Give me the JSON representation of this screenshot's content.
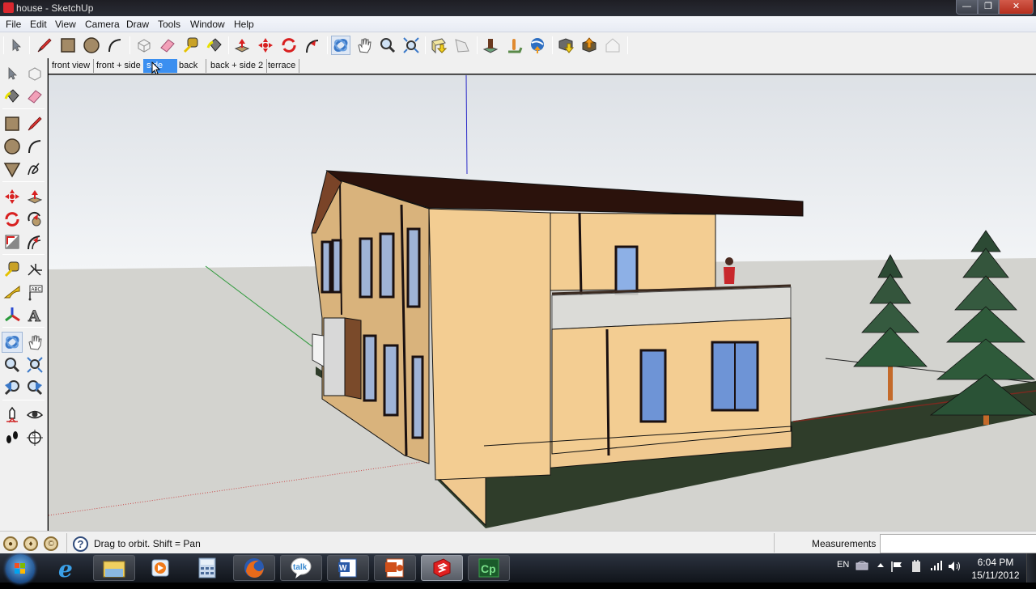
{
  "window": {
    "title": "house - SketchUp",
    "controls": {
      "minimize": "—",
      "restore": "❐",
      "close": "✕"
    }
  },
  "menu": [
    "File",
    "Edit",
    "View",
    "Camera",
    "Draw",
    "Tools",
    "Window",
    "Help"
  ],
  "toolbar": {
    "groups": [
      [
        "select-tool"
      ],
      [
        "pencil-line-tool",
        "rectangle-tool",
        "circle-tool",
        "arc-tool"
      ],
      [
        "make-component-tool",
        "eraser-tool",
        "tape-measure-tool",
        "paint-bucket-tool"
      ],
      [
        "push-pull-tool",
        "move-tool",
        "rotate-tool",
        "follow-me-tool"
      ],
      [
        "orbit-tool",
        "pan-tool",
        "zoom-tool",
        "zoom-extents-tool"
      ],
      [
        "get-models-tool",
        "share-model-tool"
      ],
      [
        "add-location-tool",
        "toggle-terrain-tool",
        "google-earth-tool"
      ],
      [
        "get-models-3dw-tool",
        "share-component-tool",
        "building-maker-tool"
      ]
    ],
    "active": "orbit-tool"
  },
  "scenes": {
    "tabs": [
      "front view",
      "front + side",
      "side",
      "back",
      "back + side 2",
      "terrace"
    ],
    "active_index": 2
  },
  "left_toolbar": {
    "rows": [
      [
        "select",
        "make-component"
      ],
      [
        "paint-bucket",
        "eraser"
      ],
      [
        "rectangle",
        "pencil-line"
      ],
      [
        "circle",
        "arc"
      ],
      [
        "polygon",
        "freehand"
      ],
      [
        "move",
        "push-pull"
      ],
      [
        "rotate",
        "follow-me"
      ],
      [
        "scale",
        "offset"
      ],
      [
        "tape-measure",
        "dimension"
      ],
      [
        "protractor",
        "text"
      ],
      [
        "axes",
        "3d-text"
      ],
      [
        "orbit",
        "pan"
      ],
      [
        "zoom",
        "zoom-window"
      ],
      [
        "previous-view",
        "zoom-extents"
      ],
      [
        "position-camera",
        "look-around"
      ],
      [
        "walk",
        "section-plane"
      ]
    ],
    "active": "orbit"
  },
  "viewport": {
    "scene": "3D model of a two-storey house with dark brown roof, beige walls, balcony with glass railing, figure on balcony, two pine trees and green lawn",
    "colors": {
      "sky_top": "#dde1e6",
      "sky_bottom": "#f2f4f6",
      "ground": "#d4d4d0",
      "wall_light": "#f3cd92",
      "wall_shade": "#e0b97e",
      "roof": "#2b120c",
      "roof_fascia": "#5a2a16",
      "lawn": "#2f3d2a",
      "glass": "#8db0e6",
      "frame": "#1a1010",
      "axis_blue": "#2a2ac8",
      "axis_green": "#2f9a3c",
      "axis_red": "#c84a4a"
    }
  },
  "status": {
    "icons": [
      "geo-location-icon",
      "credits-icon",
      "user-icon"
    ],
    "help_label": "?",
    "message": "Drag to orbit.  Shift = Pan",
    "measurements_label": "Measurements",
    "measurements_value": ""
  },
  "taskbar": {
    "apps": [
      "internet-explorer",
      "windows-explorer",
      "media-player",
      "calculator",
      "firefox",
      "google-talk",
      "word",
      "powerpoint",
      "sketchup",
      "captivate"
    ],
    "active_app": "sketchup",
    "captivate_label": "Cp",
    "talk_label": "talk",
    "tray": {
      "language": "EN",
      "time": "6:04 PM",
      "date": "15/11/2012"
    }
  }
}
